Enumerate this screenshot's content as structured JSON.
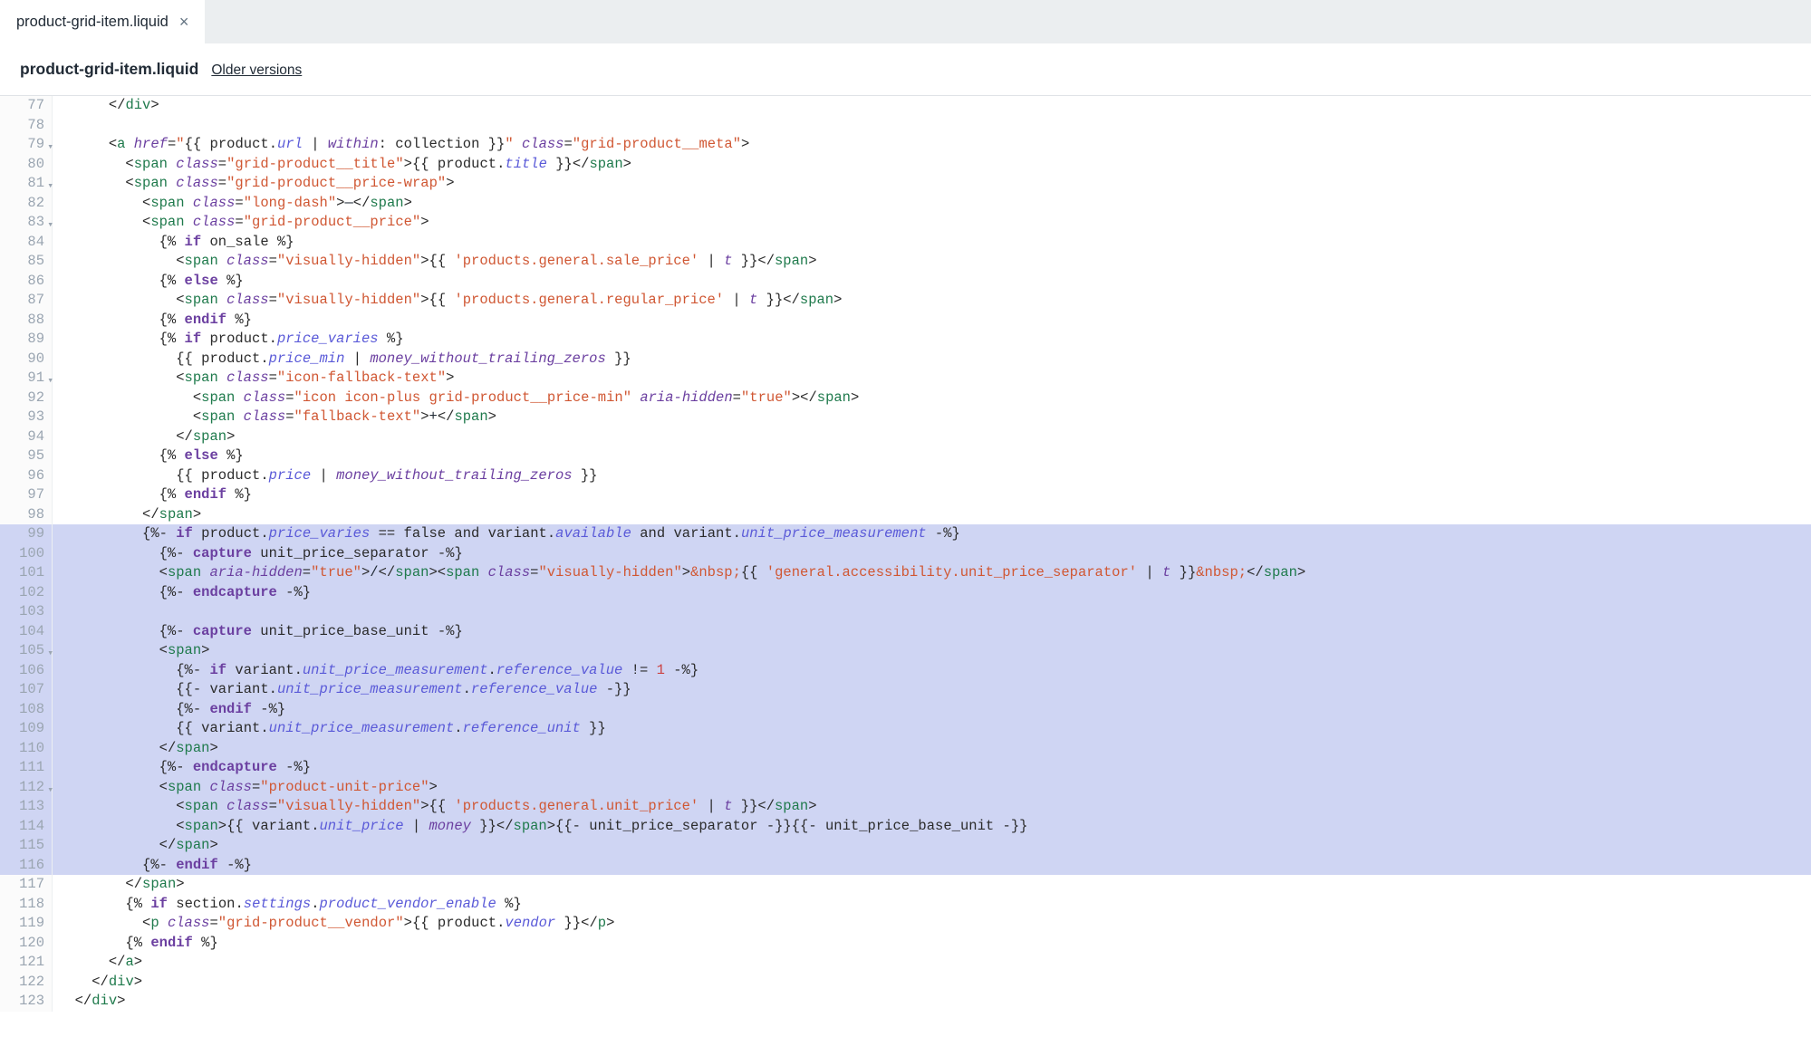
{
  "tab": {
    "label": "product-grid-item.liquid"
  },
  "subhead": {
    "title": "product-grid-item.liquid",
    "older": "Older versions"
  },
  "gutter": {
    "start": 77,
    "end": 123,
    "fold_lines": [
      79,
      81,
      83,
      91,
      105,
      112
    ]
  },
  "highlight": {
    "start": 99,
    "end": 116
  },
  "code_lines": {
    "77": "      </div>",
    "78": "",
    "79": "      <a href=\"{{ product.url | within: collection }}\" class=\"grid-product__meta\">",
    "80": "        <span class=\"grid-product__title\">{{ product.title }}</span>",
    "81": "        <span class=\"grid-product__price-wrap\">",
    "82": "          <span class=\"long-dash\">—</span>",
    "83": "          <span class=\"grid-product__price\">",
    "84": "            {% if on_sale %}",
    "85": "              <span class=\"visually-hidden\">{{ 'products.general.sale_price' | t }}</span>",
    "86": "            {% else %}",
    "87": "              <span class=\"visually-hidden\">{{ 'products.general.regular_price' | t }}</span>",
    "88": "            {% endif %}",
    "89": "            {% if product.price_varies %}",
    "90": "              {{ product.price_min | money_without_trailing_zeros }}",
    "91": "              <span class=\"icon-fallback-text\">",
    "92": "                <span class=\"icon icon-plus grid-product__price-min\" aria-hidden=\"true\"></span>",
    "93": "                <span class=\"fallback-text\">+</span>",
    "94": "              </span>",
    "95": "            {% else %}",
    "96": "              {{ product.price | money_without_trailing_zeros }}",
    "97": "            {% endif %}",
    "98": "          </span>",
    "99": "          {%- if product.price_varies == false and variant.available and variant.unit_price_measurement -%}",
    "100": "            {%- capture unit_price_separator -%}",
    "101": "            <span aria-hidden=\"true\">/</span><span class=\"visually-hidden\">&nbsp;{{ 'general.accessibility.unit_price_separator' | t }}&nbsp;</span>",
    "102": "            {%- endcapture -%}",
    "103": "",
    "104": "            {%- capture unit_price_base_unit -%}",
    "105": "            <span>",
    "106": "              {%- if variant.unit_price_measurement.reference_value != 1 -%}",
    "107": "              {{- variant.unit_price_measurement.reference_value -}}",
    "108": "              {%- endif -%}",
    "109": "              {{ variant.unit_price_measurement.reference_unit }}",
    "110": "            </span>",
    "111": "            {%- endcapture -%}",
    "112": "            <span class=\"product-unit-price\">",
    "113": "              <span class=\"visually-hidden\">{{ 'products.general.unit_price' | t }}</span>",
    "114": "              <span>{{ variant.unit_price | money }}</span>{{- unit_price_separator -}}{{- unit_price_base_unit -}}",
    "115": "            </span>",
    "116": "          {%- endif -%}",
    "117": "        </span>",
    "118": "        {% if section.settings.product_vendor_enable %}",
    "119": "          <p class=\"grid-product__vendor\">{{ product.vendor }}</p>",
    "120": "        {% endif %}",
    "121": "      </a>",
    "122": "    </div>",
    "123": "  </div>"
  }
}
